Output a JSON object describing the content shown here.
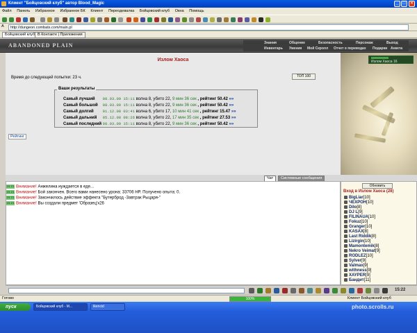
{
  "window": {
    "title": "Клиент \"Бойцовский клуб\" автор Blood_Magic",
    "min": "_",
    "max": "□",
    "close": "×"
  },
  "menu": [
    "Файл",
    "Панель",
    "Избранное",
    "Избранное БК",
    "Клиент",
    "Переодевалка",
    "Бойцовский клуб",
    "Окна",
    "Помощь"
  ],
  "address": {
    "label": "A",
    "url": "http://dungeon.combats.com/main.pl"
  },
  "tabs": [
    "Бойцовский клуб",
    "В Контакте | Приложения"
  ],
  "game": {
    "logo": "ABANDONED PLAIN",
    "nav_top": [
      "Знания",
      "Общение",
      "Безопасность",
      "Персонаж",
      "Выход"
    ],
    "nav_bottom": [
      "Инвентарь",
      "Умения",
      "Мой Скролл",
      "Отчет о переводах",
      "Подарки",
      "Анкета"
    ],
    "minimap_label": "Излом Хаоса",
    "minimap_level": "16"
  },
  "main": {
    "title": "Излом Хаоса",
    "next_attempt": "Время до следующей попытки: 23 ч.",
    "top100": "ТОП 100",
    "results_title": "Ваши результаты",
    "results": [
      {
        "label": "Самый лучший",
        "date": "08.03.09 15:11",
        "wave": "волна 8,",
        "killed": "убито 22,",
        "time": "9 мин 36 сек",
        "rating": ", рейтинг 50.42",
        "arrow": "»»"
      },
      {
        "label": "Самый большой",
        "date": "08.03.09 15:11",
        "wave": "волна 8,",
        "killed": "убито 22,",
        "time": "9 мин 36 сек",
        "rating": ", рейтинг 50.42",
        "arrow": "»»"
      },
      {
        "label": "Самый долгий",
        "date": "01.12.08 03:41",
        "wave": "волна 6,",
        "killed": "убито 17,",
        "time": "10 мин 41 сек",
        "rating": ", рейтинг 15.47",
        "arrow": "»»"
      },
      {
        "label": "Самый дальний",
        "date": "05.12.08 08:26",
        "wave": "волна 9,",
        "killed": "убито 22,",
        "time": "17 мин 35 сек",
        "rating": ", рейтинг 27.53",
        "arrow": "»»"
      },
      {
        "label": "Самый последний",
        "date": "08.03.09 15:11",
        "wave": "волна 8,",
        "killed": "убито 22,",
        "time": "9 мин 36 сек",
        "rating": ", рейтинг 50.42",
        "arrow": "»»"
      }
    ],
    "rating_button": "Рейтинг"
  },
  "chat": {
    "tab_chat": "Чат",
    "tab_system": "Системные сообщения",
    "lines": [
      {
        "ts": "15:21",
        "warn": "Внимание!",
        "text": " Анжелина нуждается в еде..."
      },
      {
        "ts": "15:21",
        "warn": "Внимание!",
        "text": " Бой закончен. Всего вами нанесено урона: 33706 HP. Получено опыта: 0."
      },
      {
        "ts": "15:21",
        "warn": "Внимание!",
        "text": " Закончилось действие эффекта \"Бутерброд -Завтрак Рыцаря-\""
      },
      {
        "ts": "15:21",
        "warn": "Внимание!",
        "text": " Вы создали предмет 'Образец'x26"
      }
    ]
  },
  "players": {
    "refresh": "Обновить",
    "title": "Вход в Излом Хаоса (28)",
    "list": [
      {
        "name": "BigLiar",
        "level": "[10]"
      },
      {
        "name": "ЧЕХРОН",
        "level": "[10]"
      },
      {
        "name": "Dilo",
        "level": "[8]"
      },
      {
        "name": "DJ L",
        "level": "[9]"
      },
      {
        "name": "FILINAUA",
        "level": "[10]"
      },
      {
        "name": "Fokuz",
        "level": "[10]"
      },
      {
        "name": "Granger",
        "level": "[10]"
      },
      {
        "name": "KASAX",
        "level": "[8]"
      },
      {
        "name": "Last Riddik",
        "level": "[8]"
      },
      {
        "name": "Lizirgin",
        "level": "[10]"
      },
      {
        "name": "Mamontemik",
        "level": "[8]"
      },
      {
        "name": "Nekro Veimat",
        "level": "[9]"
      },
      {
        "name": "RODLEZ",
        "level": "[10]"
      },
      {
        "name": "Sylver",
        "level": "[9]"
      },
      {
        "name": "Valmax",
        "level": "[9]"
      },
      {
        "name": "withness",
        "level": "[9]"
      },
      {
        "name": "XAYPER",
        "level": "[9]"
      },
      {
        "name": "Бандит",
        "level": "[11]"
      }
    ]
  },
  "bottom": {
    "clock": "15:22"
  },
  "status": {
    "ready": "Готово",
    "progress": 100,
    "progress_label": "100%",
    "site": "Клиент Бойцовский клуб"
  },
  "taskbar": {
    "start": "пуск",
    "tasks": [
      "Бойцовский клуб - M...",
      "tkencid"
    ],
    "watermark": "photo.scrolls.ru"
  },
  "colors": {
    "accent_red": "#a81d1d",
    "date_green": "#2a7a2a",
    "taskbar_blue": "#245edb",
    "start_green": "#3fae3f",
    "progress_green": "#3cb43c"
  }
}
